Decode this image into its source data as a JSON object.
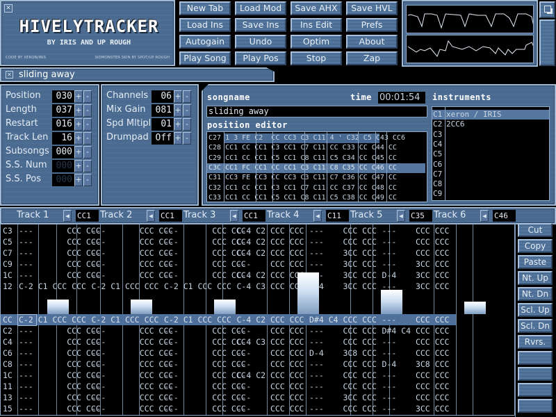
{
  "logo": {
    "title": "HivelyTracker",
    "subtitle": "by IRIS and Up Rough",
    "credit_code": "code by xeron/IRIS",
    "credit_skin": "sidmonster skin by spot/up rough"
  },
  "toolbar": {
    "buttons": [
      [
        "New Tab",
        "Load Mod",
        "Save AHX",
        "Save HVL"
      ],
      [
        "Load Ins",
        "Save Ins",
        "Ins Edit",
        "Prefs"
      ],
      [
        "Autogain",
        "Undo",
        "Optim",
        "About"
      ],
      [
        "Play Song",
        "Play Pos",
        "Stop",
        "Zap"
      ]
    ]
  },
  "tab_bar": {
    "tab_label": "sliding away"
  },
  "song_settings": {
    "rows": [
      {
        "label": "Position",
        "value": "030"
      },
      {
        "label": "Length",
        "value": "037"
      },
      {
        "label": "Restart",
        "value": "016"
      },
      {
        "label": "Track Len",
        "value": "16"
      },
      {
        "label": "Subsongs",
        "value": "000"
      },
      {
        "label": "S.S. Num",
        "value": "000",
        "disabled": true
      },
      {
        "label": "S.S. Pos",
        "value": "000",
        "disabled": true
      }
    ]
  },
  "mix_settings": {
    "rows": [
      {
        "label": "Channels",
        "value": "06"
      },
      {
        "label": "Mix Gain",
        "value": "081"
      },
      {
        "label": "Spd Mltipl",
        "value": "01"
      },
      {
        "label": "Drumpad",
        "value": "Off"
      }
    ]
  },
  "plus_label": "+",
  "minus_label": "-",
  "song": {
    "songname_title": "Songname",
    "time_title": "Time",
    "time": "00:01:54",
    "songname": "sliding away",
    "position_editor_title": "Position Editor",
    "position_rows": [
      "C27 1 3 FE C2  CC CC3 C3 C11 4 ' C32 C5 C43 CC6",
      "C28 CC1 CC CC1 C3 CC1 C7 C11 CC C33 CC C44 CC",
      "C29 CC1 CC CC1 C5 CC1 C8 C11 C5 C34 CC C45 CC",
      "C3C CC1 FC CC1 CC CC1 C3 C11 C8 C35 CC C46 CC",
      "C31 CC3 FE CC3 CC CC3 C3 C11 C7 C36 CC C47 CC",
      "C32 CC1 CC CC1 C3 CC1 C7 C11 CC C37 CC C48 CC",
      "C33 CC1 CC CC1 C5 CC1 C8 C11 C5 C38 CC C49 CC"
    ],
    "position_current_row": 3
  },
  "instruments": {
    "title": "Instruments",
    "items": [
      {
        "num": "C1",
        "name": "xeron / IRIS"
      },
      {
        "num": "C2",
        "name": "2CC6"
      },
      {
        "num": "C3",
        "name": ""
      },
      {
        "num": "C4",
        "name": ""
      },
      {
        "num": "C5",
        "name": ""
      },
      {
        "num": "C6",
        "name": ""
      },
      {
        "num": "C7",
        "name": ""
      },
      {
        "num": "C8",
        "name": ""
      },
      {
        "num": "C9",
        "name": ""
      }
    ],
    "selected": 0
  },
  "tracks": [
    {
      "label": "Track 1",
      "pos": "CC1",
      "vu": 0.3
    },
    {
      "label": "Track 2",
      "pos": "CC1",
      "vu": 0.3
    },
    {
      "label": "Track 3",
      "pos": "CC1",
      "vu": 0.3
    },
    {
      "label": "Track 4",
      "pos": "C11",
      "vu": 0.85
    },
    {
      "label": "Track 5",
      "pos": "C35",
      "vu": 0.5
    },
    {
      "label": "Track 6",
      "pos": "C46",
      "vu": 0.25
    }
  ],
  "pattern": {
    "current_row": 8,
    "rows": [
      {
        "n": "C3",
        "c": [
          "---       CCC CCC",
          "---       CCC CCC",
          "---       CCC CCC",
          "C-4 C2 CCC CCC",
          "---    CCC CCC",
          "---    CCC CCC"
        ]
      },
      {
        "n": "C5",
        "c": [
          "---       CCC CCC",
          "---       CCC CCC",
          "---       CCC CCC",
          "C-4 C2 CCC CCC",
          "---    CCC CCC",
          "---    CCC CCC"
        ]
      },
      {
        "n": "C7",
        "c": [
          "---       CCC CCC",
          "---       CCC CCC",
          "---       CCC CCC",
          "C-4 C2 CCC CCC",
          "---    3CC CCC",
          "---    CCC CCC"
        ]
      },
      {
        "n": "C9",
        "c": [
          "---       CCC CCC",
          "---       CCC CCC",
          "---       CCC CCC",
          "---    CCC CCC",
          "---    3CC CCC",
          "---    3CC CCC"
        ]
      },
      {
        "n": "1C",
        "c": [
          "---       CCC CCC",
          "---       CCC CCC",
          "---       CCC CCC",
          "C-4 C2 CCC CCC",
          "---    3CC CCC",
          "D-4    3CC CCC"
        ]
      },
      {
        "n": "12",
        "c": [
          "C-2 C1 CCC CCC",
          "C-2 C1 CCC CCC",
          "C-2 C1 CCC CCC",
          "C-4 C3 CCC CCC",
          "D#4    3CC CCC",
          "---    3CC CCC"
        ]
      },
      {
        "n": "",
        "c": [
          "",
          "",
          "",
          "",
          "",
          ""
        ]
      },
      {
        "n": "",
        "c": [
          "",
          "",
          "",
          "",
          "",
          ""
        ]
      },
      {
        "n": "CC",
        "c": [
          "C-2 C1 CCC CCC",
          "C-2 C1 CCC CCC",
          "C-2 C1 CCC CCC",
          "C-4 C2 CCC CCC",
          "D#4 C4 CCC CCC",
          "---    CCC CCC"
        ]
      },
      {
        "n": "C2",
        "c": [
          "---       CCC CCC",
          "---       CCC CCC",
          "---       CCC CCC",
          "---    CCC CCC",
          "---    CCC CCC",
          "D#4 C4 CCC CCC"
        ]
      },
      {
        "n": "C4",
        "c": [
          "---       CCC CCC",
          "---       CCC CCC",
          "---       CCC CCC",
          "C-4 C3 CCC CCC",
          "---    CCC CCC",
          "---    CCC CCC"
        ]
      },
      {
        "n": "C6",
        "c": [
          "---       CCC CCC",
          "---       CCC CCC",
          "---       CCC CCC",
          "---    CCC CCC",
          "D-4    3C8 CCC",
          "---    CCC CCC"
        ]
      },
      {
        "n": "C8",
        "c": [
          "---       CCC CCC",
          "---       CCC CCC",
          "---       CCC CCC",
          "---    CCC CCC",
          "---    CCC CCC",
          "D-4    3C8 CCC"
        ]
      },
      {
        "n": "1C",
        "c": [
          "---       CCC CCC",
          "---       CCC CCC",
          "---       CCC CCC",
          "C-4 C2 CCC CCC",
          "---    CCC CCC",
          "---    CCC CCC"
        ]
      },
      {
        "n": "11",
        "c": [
          "---       CCC CCC",
          "---       CCC CCC",
          "---       CCC CCC",
          "---    CCC CCC",
          "---    CCC CCC",
          "---    CCC CCC"
        ]
      },
      {
        "n": "13",
        "c": [
          "---       CCC CCC",
          "---       CCC CCC",
          "---       CCC CCC",
          "---    CCC CCC",
          "---    3CC CCC",
          "---    CCC CCC"
        ]
      },
      {
        "n": "15",
        "c": [
          "---       CCC CCC",
          "---       CCC CCC",
          "---       CCC CCC",
          "---    CCC CCC",
          "---    CCC CCC",
          "---    3CC CCC"
        ]
      }
    ]
  },
  "edit_buttons": [
    "Cut",
    "Copy",
    "Paste",
    "Nt. Up",
    "Nt. Dn",
    "Scl. Up",
    "Scl. Dn",
    "Rvrs.",
    "",
    "",
    "",
    ""
  ],
  "colors": {
    "panel": "#4a6a8f",
    "border": "#9fb8d4",
    "highlight": "#56779f",
    "text": "#dbe6f2"
  }
}
